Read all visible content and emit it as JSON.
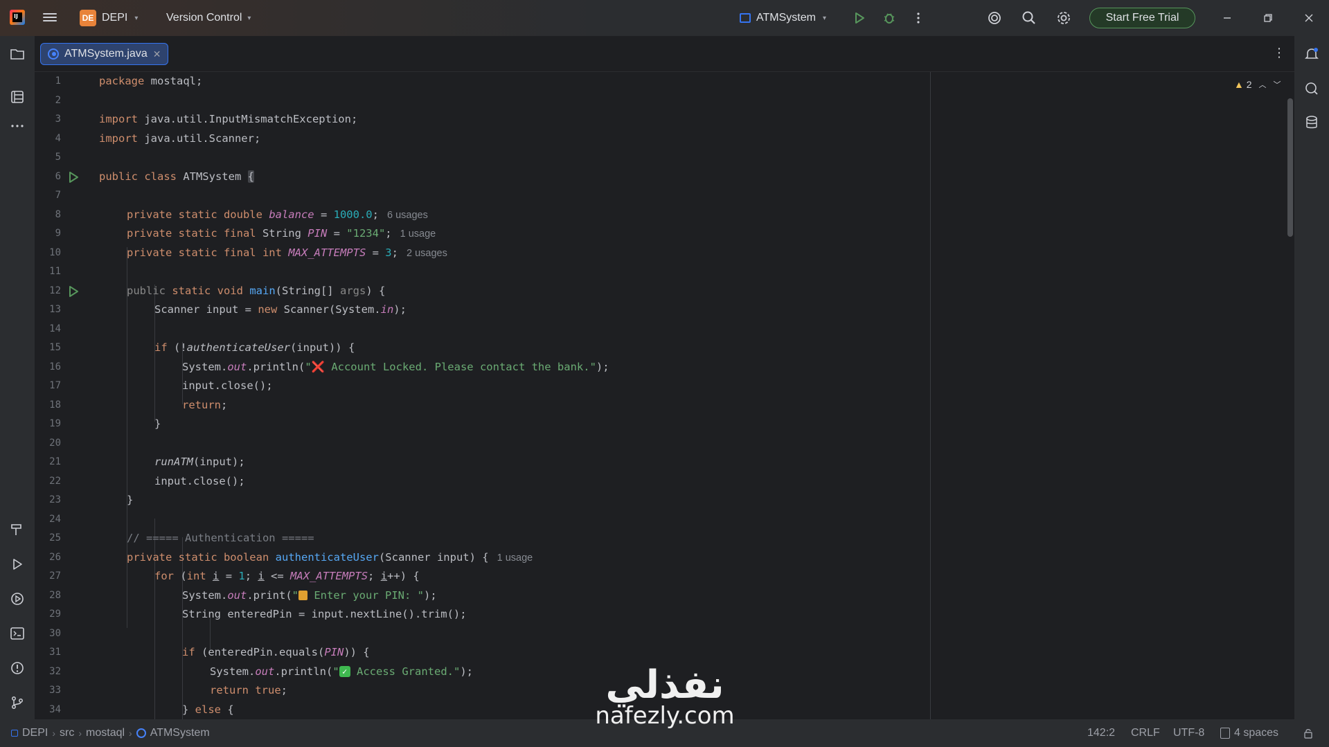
{
  "titlebar": {
    "project_badge": "DE",
    "project_name": "DEPI",
    "version_control": "Version Control",
    "run_config": "ATMSystem",
    "trial_button": "Start Free Trial"
  },
  "editor": {
    "tab_label": "ATMSystem.java",
    "warnings_count": "2",
    "lines": [
      {
        "n": "1"
      },
      {
        "n": "2"
      },
      {
        "n": "3"
      },
      {
        "n": "4"
      },
      {
        "n": "5"
      },
      {
        "n": "6"
      },
      {
        "n": "7"
      },
      {
        "n": "8"
      },
      {
        "n": "9"
      },
      {
        "n": "10"
      },
      {
        "n": "11"
      },
      {
        "n": "12"
      },
      {
        "n": "13"
      },
      {
        "n": "14"
      },
      {
        "n": "15"
      },
      {
        "n": "16"
      },
      {
        "n": "17"
      },
      {
        "n": "18"
      },
      {
        "n": "19"
      },
      {
        "n": "20"
      },
      {
        "n": "21"
      },
      {
        "n": "22"
      },
      {
        "n": "23"
      },
      {
        "n": "24"
      },
      {
        "n": "25"
      },
      {
        "n": "26"
      },
      {
        "n": "27"
      },
      {
        "n": "28"
      },
      {
        "n": "29"
      },
      {
        "n": "30"
      },
      {
        "n": "31"
      },
      {
        "n": "32"
      },
      {
        "n": "33"
      },
      {
        "n": "34"
      }
    ],
    "code": {
      "l1_kw": "package",
      "l1_rest": " mostaql;",
      "l3_kw": "import",
      "l3_rest": " java.util.InputMismatchException;",
      "l4_kw": "import",
      "l4_rest": " java.util.Scanner;",
      "l6_kw": "public class",
      "l6_name": " ATMSystem ",
      "l6_brace": "{",
      "l8_kw": "private static double",
      "l8_field": "balance",
      "l8_eq": " = ",
      "l8_num": "1000.0",
      "l8_end": ";",
      "l8_hint": "6 usages",
      "l9_kw": "private static final",
      "l9_type": " String ",
      "l9_field": "PIN",
      "l9_eq": " = ",
      "l9_str": "\"1234\"",
      "l9_end": ";",
      "l9_hint": "1 usage",
      "l10_kw": "private static final int",
      "l10_field": "MAX_ATTEMPTS",
      "l10_eq": " = ",
      "l10_num": "3",
      "l10_end": ";",
      "l10_hint": "2 usages",
      "l12_kw1": "public",
      "l12_kw2": " static void ",
      "l12_fn": "main",
      "l12_a": "(String[] ",
      "l12_param": "args",
      "l12_b": ") {",
      "l13_a": "Scanner input = ",
      "l13_kw": "new",
      "l13_b": " Scanner(System.",
      "l13_field": "in",
      "l13_c": ");",
      "l15_kw": "if",
      "l15_a": " (!",
      "l15_fn": "authenticateUser",
      "l15_b": "(input)) {",
      "l16_a": "System.",
      "l16_field": "out",
      "l16_b": ".println(",
      "l16_str1": "\"",
      "l16_emoji": "❌",
      "l16_str2": " Account Locked. Please contact the bank.\"",
      "l16_c": ");",
      "l17": "input.close();",
      "l18_kw": "return",
      "l18_end": ";",
      "l19": "}",
      "l21_fn": "runATM",
      "l21_rest": "(input);",
      "l22": "input.close();",
      "l23": "}",
      "l25": "// ===== Authentication =====",
      "l26_kw": "private static boolean",
      "l26_fn": "authenticateUser",
      "l26_rest": "(Scanner input) {",
      "l26_hint": "1 usage",
      "l27_kw": "for",
      "l27_a": " (",
      "l27_kw2": "int",
      "l27_i1": "i",
      "l27_b": " = ",
      "l27_num": "1",
      "l27_c": "; ",
      "l27_i2": "i",
      "l27_d": " <= ",
      "l27_field": "MAX_ATTEMPTS",
      "l27_e": "; ",
      "l27_i3": "i",
      "l27_f": "++) {",
      "l28_a": "System.",
      "l28_field": "out",
      "l28_b": ".print(",
      "l28_str1": "\"",
      "l28_str2": " Enter your PIN: \"",
      "l28_c": ");",
      "l29": "String enteredPin = input.nextLine().trim();",
      "l31_kw": "if",
      "l31_a": " (enteredPin.equals(",
      "l31_field": "PIN",
      "l31_b": ")) {",
      "l32_a": "System.",
      "l32_field": "out",
      "l32_b": ".println(",
      "l32_str1": "\"",
      "l32_emoji": "✓",
      "l32_str2": " Access Granted.\"",
      "l32_c": ");",
      "l33_kw": "return true",
      "l33_end": ";",
      "l34_a": "} ",
      "l34_kw": "else",
      "l34_b": " {"
    }
  },
  "statusbar": {
    "crumb_project": "DEPI",
    "crumb_src": "src",
    "crumb_pkg": "mostaql",
    "crumb_class": "ATMSystem",
    "position": "142:2",
    "line_sep": "CRLF",
    "encoding": "UTF-8",
    "indent": "4 spaces"
  },
  "watermark": {
    "arabic": "نفذلي",
    "latin": "nafezly.com"
  },
  "colors": {
    "accent": "#3574f0",
    "keyword": "#cf8e6d",
    "string": "#6aab73",
    "number": "#2aacb8",
    "field": "#c77dbb",
    "function": "#56a8f5",
    "trial_border": "#57965c"
  }
}
